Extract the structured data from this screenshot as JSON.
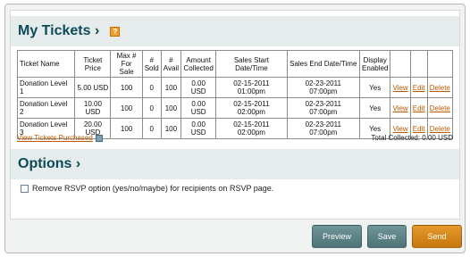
{
  "tickets_section": {
    "title": "My Tickets ›",
    "help_icon": "help-icon"
  },
  "table": {
    "headers": [
      "Ticket Name",
      "Ticket Price",
      "Max # For Sale",
      "# Sold",
      "# Avail",
      "Amount Collected",
      "Sales Start Date/Time",
      "Sales End Date/Time",
      "Display Enabled",
      "",
      "",
      ""
    ],
    "rows": [
      {
        "name": "Donation Level 1",
        "price": "5.00 USD",
        "max": "100",
        "sold": "0",
        "avail": "100",
        "amount": "0.00 USD",
        "start_date": "02-15-2011",
        "start_time": "01:00pm",
        "end_date": "02-23-2011",
        "end_time": "07:00pm",
        "display": "Yes",
        "view": "View",
        "edit": "Edit",
        "delete": "Delete"
      },
      {
        "name": "Donation Level 2",
        "price": "10.00 USD",
        "max": "100",
        "sold": "0",
        "avail": "100",
        "amount": "0.00 USD",
        "start_date": "02-15-2011",
        "start_time": "02:00pm",
        "end_date": "02-23-2011",
        "end_time": "07:00pm",
        "display": "Yes",
        "view": "View",
        "edit": "Edit",
        "delete": "Delete"
      },
      {
        "name": "Donation Level 3",
        "price": "20.00 USD",
        "max": "100",
        "sold": "0",
        "avail": "100",
        "amount": "0.00 USD",
        "start_date": "02-15-2011",
        "start_time": "02:00pm",
        "end_date": "02-23-2011",
        "end_time": "07:00pm",
        "display": "Yes",
        "view": "View",
        "edit": "Edit",
        "delete": "Delete"
      }
    ],
    "view_purchased_label": "View Tickets Purchased",
    "total_collected": "Total Collected: 0.00 USD"
  },
  "options_section": {
    "title": "Options ›",
    "rsvp_label": "Remove RSVP option (yes/no/maybe) for recipients on RSVP page.",
    "rsvp_checked": false
  },
  "buttons": {
    "preview": "Preview",
    "save": "Save",
    "send": "Send"
  },
  "colors": {
    "heading": "#0d4b5a",
    "link": "#c05a00",
    "teal_button": "#5d8487",
    "orange_button": "#d5861c"
  }
}
